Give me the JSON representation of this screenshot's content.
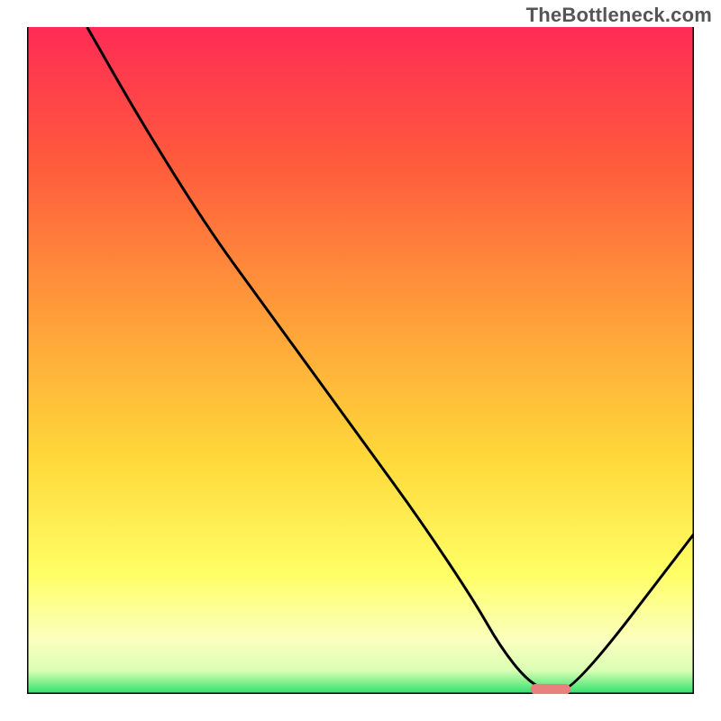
{
  "watermark": "TheBottleneck.com",
  "chart_data": {
    "type": "line",
    "title": "",
    "xlabel": "",
    "ylabel": "",
    "xlim": [
      0,
      100
    ],
    "ylim": [
      0,
      100
    ],
    "grid": false,
    "legend": false,
    "background_gradient_stops": [
      {
        "pct": 0.0,
        "color": "#ff2b56"
      },
      {
        "pct": 0.2,
        "color": "#ff5a3c"
      },
      {
        "pct": 0.45,
        "color": "#ffa33a"
      },
      {
        "pct": 0.65,
        "color": "#ffd93a"
      },
      {
        "pct": 0.82,
        "color": "#ffff66"
      },
      {
        "pct": 0.92,
        "color": "#fbffbf"
      },
      {
        "pct": 0.965,
        "color": "#d9ffb3"
      },
      {
        "pct": 1.0,
        "color": "#2be06b"
      }
    ],
    "series": [
      {
        "name": "bottleneck-curve",
        "color": "#000000",
        "x": [
          9,
          17,
          27,
          35,
          43,
          51,
          59,
          67,
          71,
          75,
          78,
          82,
          100
        ],
        "y": [
          100,
          86,
          70,
          59,
          48,
          37,
          26,
          14,
          7,
          2,
          0.5,
          0.5,
          24
        ]
      }
    ],
    "marker": {
      "name": "optimal-range",
      "color": "#e8807d",
      "x_center": 78.5,
      "y": 0.7,
      "width": 6,
      "height": 1.6
    }
  }
}
